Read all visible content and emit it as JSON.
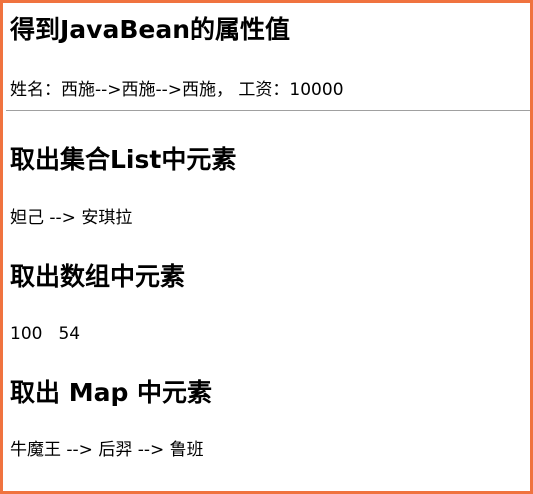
{
  "sections": [
    {
      "title": "得到JavaBean的属性值",
      "content": "姓名：西施-->西施-->西施， 工资：10000"
    },
    {
      "title": "取出集合List中元素",
      "content": "妲己 --> 安琪拉"
    },
    {
      "title": "取出数组中元素",
      "items": [
        "100",
        "54"
      ]
    },
    {
      "title": "取出 Map 中元素",
      "content": "牛魔王 --> 后羿 --> 鲁班"
    }
  ],
  "colors": {
    "frame_border": "#f0733f",
    "divider": "#a0a0a0"
  }
}
